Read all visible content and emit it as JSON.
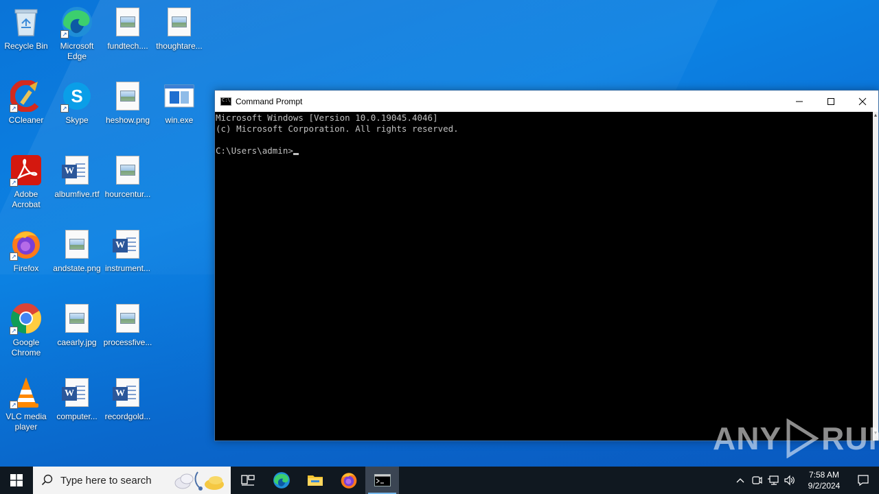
{
  "desktop": {
    "icons": [
      {
        "label": "Recycle Bin",
        "icon": "recycle-bin-icon"
      },
      {
        "label": "Microsoft Edge",
        "icon": "edge-icon"
      },
      {
        "label": "fundtech....",
        "icon": "image-file-icon"
      },
      {
        "label": "thoughtare...",
        "icon": "image-file-icon"
      },
      {
        "label": "CCleaner",
        "icon": "ccleaner-icon"
      },
      {
        "label": "Skype",
        "icon": "skype-icon"
      },
      {
        "label": "heshow.png",
        "icon": "image-file-icon"
      },
      {
        "label": "win.exe",
        "icon": "exe-file-icon"
      },
      {
        "label": "Adobe Acrobat",
        "icon": "acrobat-icon"
      },
      {
        "label": "albumfive.rtf",
        "icon": "word-file-icon"
      },
      {
        "label": "hourcentur...",
        "icon": "image-file-icon"
      },
      {
        "label": "Firefox",
        "icon": "firefox-icon"
      },
      {
        "label": "andstate.png",
        "icon": "image-file-icon"
      },
      {
        "label": "instrument...",
        "icon": "word-file-icon"
      },
      {
        "label": "Google Chrome",
        "icon": "chrome-icon"
      },
      {
        "label": "caearly.jpg",
        "icon": "image-file-icon"
      },
      {
        "label": "processfive...",
        "icon": "image-file-icon"
      },
      {
        "label": "VLC media player",
        "icon": "vlc-icon"
      },
      {
        "label": "computer...",
        "icon": "word-file-icon"
      },
      {
        "label": "recordgold...",
        "icon": "word-file-icon"
      }
    ]
  },
  "cmd": {
    "title": "Command Prompt",
    "lines": [
      "Microsoft Windows [Version 10.0.19045.4046]",
      "(c) Microsoft Corporation. All rights reserved.",
      "",
      "C:\\Users\\admin>"
    ]
  },
  "watermark": {
    "left": "ANY",
    "right": "RUN"
  },
  "taskbar": {
    "search_placeholder": "Type here to search",
    "apps": [
      "task-view-icon",
      "edge-icon",
      "file-explorer-icon",
      "firefox-icon",
      "command-prompt-icon"
    ],
    "time": "7:58 AM",
    "date": "9/2/2024"
  },
  "colors": {
    "desktop_bg": "#0b78dc",
    "taskbar_bg": "#101820",
    "console_text": "#c0c0c0",
    "console_bg": "#000000"
  }
}
